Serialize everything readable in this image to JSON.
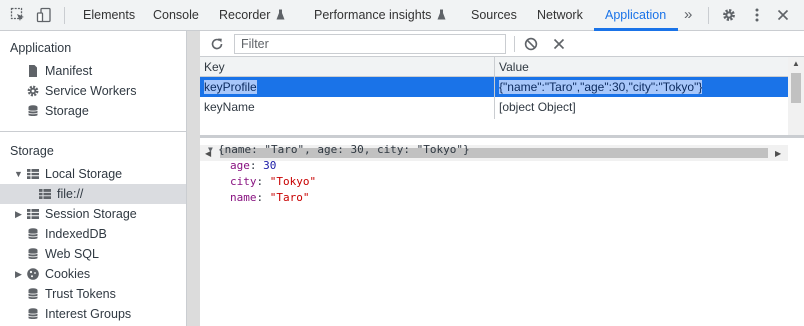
{
  "tabs": [
    {
      "label": "Elements"
    },
    {
      "label": "Console"
    },
    {
      "label": "Recorder"
    },
    {
      "label": "Performance insights"
    },
    {
      "label": "Sources"
    },
    {
      "label": "Network"
    },
    {
      "label": "Application"
    }
  ],
  "active_tab": "Application",
  "accent_color": "#1a73e8",
  "toolbar_icons": [
    "inspect-element-icon",
    "device-toggle-icon",
    "flask-icon",
    "more-tabs-icon",
    "settings-gear-icon",
    "kebab-menu-icon",
    "close-icon"
  ],
  "sidebar": {
    "application_heading": "Application",
    "application_items": [
      {
        "label": "Manifest",
        "icon": "document-icon"
      },
      {
        "label": "Service Workers",
        "icon": "gear-icon"
      },
      {
        "label": "Storage",
        "icon": "database-icon"
      }
    ],
    "storage_heading": "Storage",
    "local_storage": {
      "label": "Local Storage",
      "icon": "grid-icon",
      "expanded": true,
      "children": [
        {
          "label": "file://",
          "selected": true
        }
      ]
    },
    "session_storage": {
      "label": "Session Storage",
      "icon": "grid-icon",
      "expanded": false
    },
    "indexeddb": {
      "label": "IndexedDB",
      "icon": "database-icon"
    },
    "websql": {
      "label": "Web SQL",
      "icon": "database-icon"
    },
    "cookies": {
      "label": "Cookies",
      "icon": "cookie-icon",
      "expanded": false
    },
    "trust_tokens": {
      "label": "Trust Tokens",
      "icon": "database-icon"
    },
    "interest_groups": {
      "label": "Interest Groups",
      "icon": "database-icon"
    }
  },
  "toolbar": {
    "filter_placeholder": "Filter",
    "refresh_icon": "refresh-icon",
    "clear_all_icon": "block-icon",
    "delete_icon": "close-icon"
  },
  "table": {
    "headers": {
      "key": "Key",
      "value": "Value"
    },
    "rows": [
      {
        "key": "keyProfile",
        "value": "{\"name\":\"Taro\",\"age\":30,\"city\":\"Tokyo\"}",
        "selected": true
      },
      {
        "key": "keyName",
        "value": "[object Object]",
        "selected": false
      }
    ]
  },
  "preview": {
    "summary": "{name: \"Taro\", age: 30, city: \"Tokyo\"}",
    "props": [
      {
        "key": "age",
        "value": "30",
        "type": "number"
      },
      {
        "key": "city",
        "value": "\"Tokyo\"",
        "type": "string"
      },
      {
        "key": "name",
        "value": "\"Taro\"",
        "type": "string"
      }
    ]
  }
}
